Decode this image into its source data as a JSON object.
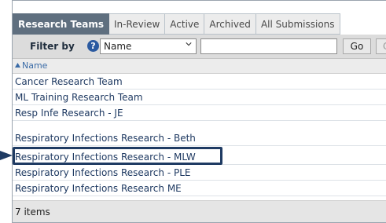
{
  "tabs": [
    {
      "label": "Research Teams",
      "active": true
    },
    {
      "label": "In-Review",
      "active": false
    },
    {
      "label": "Active",
      "active": false
    },
    {
      "label": "Archived",
      "active": false
    },
    {
      "label": "All Submissions",
      "active": false
    }
  ],
  "filter": {
    "label": "Filter by",
    "help_icon": "?",
    "selected_field": "Name",
    "text_value": "",
    "go_label": "Go",
    "clear_label": "C"
  },
  "list": {
    "column_header": "Name",
    "sort_icon": "sort-ascending-icon",
    "rows": [
      "Cancer Research Team",
      "ML Training Research Team",
      "Resp Infe Research - JE",
      "Respiratory Infections Research - Beth",
      "Respiratory Infections Research - MLW",
      "Respiratory Infections Research - PLE",
      "Respiratory Infections Research ME"
    ],
    "footer": "7 items"
  },
  "colors": {
    "active_tab": "#5f6f7f",
    "highlight_border": "#1f3b63",
    "arrow": "#1f3b63",
    "link_text": "#1f3a62"
  }
}
